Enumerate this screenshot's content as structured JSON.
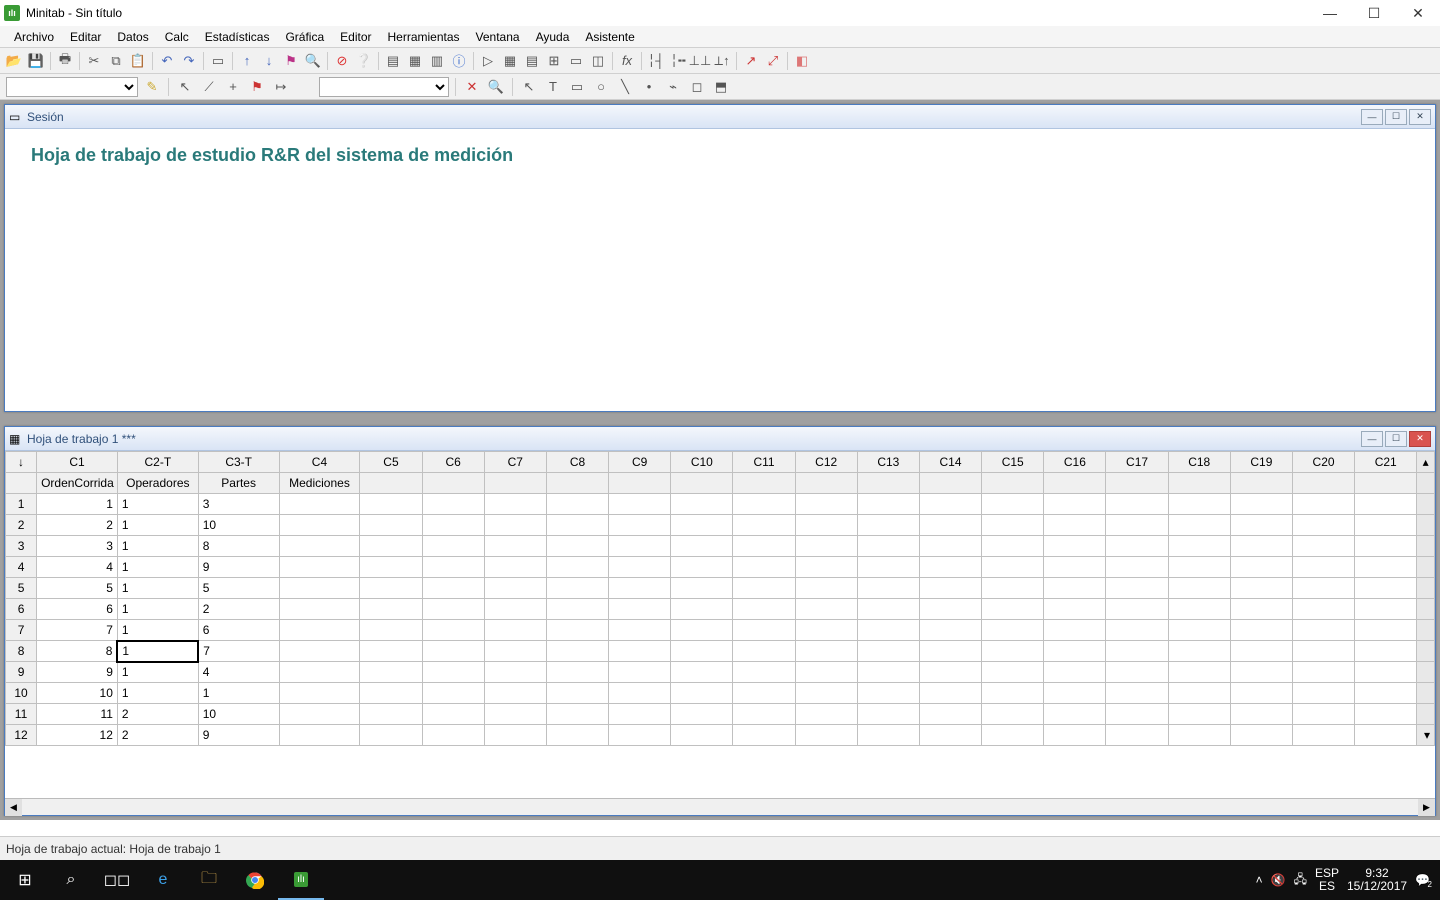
{
  "app": {
    "title": "Minitab - Sin título"
  },
  "menu": [
    "Archivo",
    "Editar",
    "Datos",
    "Calc",
    "Estadísticas",
    "Gráfica",
    "Editor",
    "Herramientas",
    "Ventana",
    "Ayuda",
    "Asistente"
  ],
  "session": {
    "title": "Sesión",
    "heading": "Hoja de trabajo de estudio R&R del sistema de medición"
  },
  "worksheet": {
    "title": "Hoja de trabajo 1 ***",
    "cols": [
      "C1",
      "C2-T",
      "C3-T",
      "C4",
      "C5",
      "C6",
      "C7",
      "C8",
      "C9",
      "C10",
      "C11",
      "C12",
      "C13",
      "C14",
      "C15",
      "C16",
      "C17",
      "C18",
      "C19",
      "C20",
      "C21"
    ],
    "names": [
      "OrdenCorrida",
      "Operadores",
      "Partes",
      "Mediciones",
      "",
      "",
      "",
      "",
      "",
      "",
      "",
      "",
      "",
      "",
      "",
      "",
      "",
      "",
      "",
      "",
      ""
    ],
    "rows": [
      {
        "r": "1",
        "c1": "1",
        "c2": "1",
        "c3": "3",
        "c4": ""
      },
      {
        "r": "2",
        "c1": "2",
        "c2": "1",
        "c3": "10",
        "c4": ""
      },
      {
        "r": "3",
        "c1": "3",
        "c2": "1",
        "c3": "8",
        "c4": ""
      },
      {
        "r": "4",
        "c1": "4",
        "c2": "1",
        "c3": "9",
        "c4": ""
      },
      {
        "r": "5",
        "c1": "5",
        "c2": "1",
        "c3": "5",
        "c4": ""
      },
      {
        "r": "6",
        "c1": "6",
        "c2": "1",
        "c3": "2",
        "c4": ""
      },
      {
        "r": "7",
        "c1": "7",
        "c2": "1",
        "c3": "6",
        "c4": ""
      },
      {
        "r": "8",
        "c1": "8",
        "c2": "1",
        "c3": "7",
        "c4": ""
      },
      {
        "r": "9",
        "c1": "9",
        "c2": "1",
        "c3": "4",
        "c4": ""
      },
      {
        "r": "10",
        "c1": "10",
        "c2": "1",
        "c3": "1",
        "c4": ""
      },
      {
        "r": "11",
        "c1": "11",
        "c2": "2",
        "c3": "10",
        "c4": ""
      },
      {
        "r": "12",
        "c1": "12",
        "c2": "2",
        "c3": "9",
        "c4": ""
      }
    ],
    "active_row_index": 7,
    "active_col": "c2"
  },
  "status": "Hoja de trabajo actual: Hoja de trabajo 1",
  "tray": {
    "lang1": "ESP",
    "lang2": "ES",
    "time": "9:32",
    "date": "15/12/2017",
    "notif": "2"
  }
}
